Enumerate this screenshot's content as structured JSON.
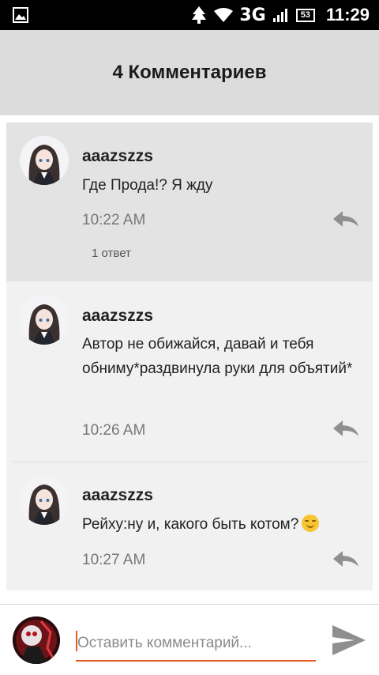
{
  "status_bar": {
    "network": "3G",
    "battery": "53",
    "time": "11:29",
    "icons": [
      "image-icon",
      "tree-icon",
      "wifi-icon",
      "signal-icon",
      "battery-icon"
    ]
  },
  "header": {
    "title": "4 Комментариев"
  },
  "comments": [
    {
      "username": "aaazszzs",
      "text": "Где Прода!? Я жду",
      "time": "10:22 AM",
      "replies_label": "1 ответ",
      "highlighted": true
    },
    {
      "username": "aaazszzs",
      "text": "Автор не обижайся, давай и тебя обниму*раздвинула руки для объятий*",
      "time": "10:26 AM"
    },
    {
      "username": "aaazszzs",
      "text": "Рейху:ну и, какого быть котом?",
      "time": "10:27 AM",
      "emoji": "smirk-emoji"
    }
  ],
  "input_bar": {
    "placeholder": "Оставить комментарий..."
  },
  "colors": {
    "accent": "#e65a1f",
    "header_bg": "#dcdcdc",
    "list_bg": "#f2f1f2",
    "highlight_bg": "#e3e3e4"
  }
}
